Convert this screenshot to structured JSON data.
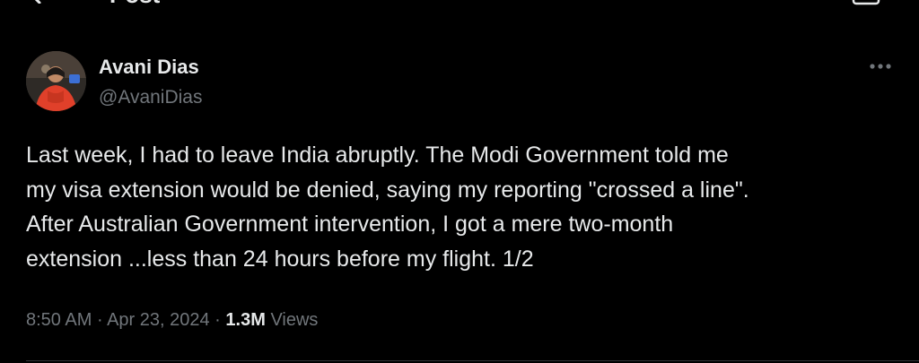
{
  "header": {
    "title": "Post"
  },
  "author": {
    "display_name": "Avani Dias",
    "handle": "@AvaniDias"
  },
  "tweet": {
    "lines": [
      "Last week, I had to leave India abruptly. The Modi Government told me",
      "my visa extension would be denied, saying my reporting \"crossed a line\".",
      "After Australian Government intervention, I got a mere two-month",
      "extension ...less than 24 hours before my flight. 1/2"
    ]
  },
  "meta": {
    "time": "8:50 AM",
    "separator": "·",
    "date": "Apr 23, 2024",
    "views_count": "1.3M",
    "views_label": "Views"
  },
  "icons": {
    "back": "back-arrow-icon",
    "more": "more-horizontal-icon",
    "reply": "reply-icon"
  },
  "colors": {
    "background": "#000000",
    "primary_text": "#e7e9ea",
    "secondary_text": "#71767b",
    "divider": "#2f3336"
  }
}
